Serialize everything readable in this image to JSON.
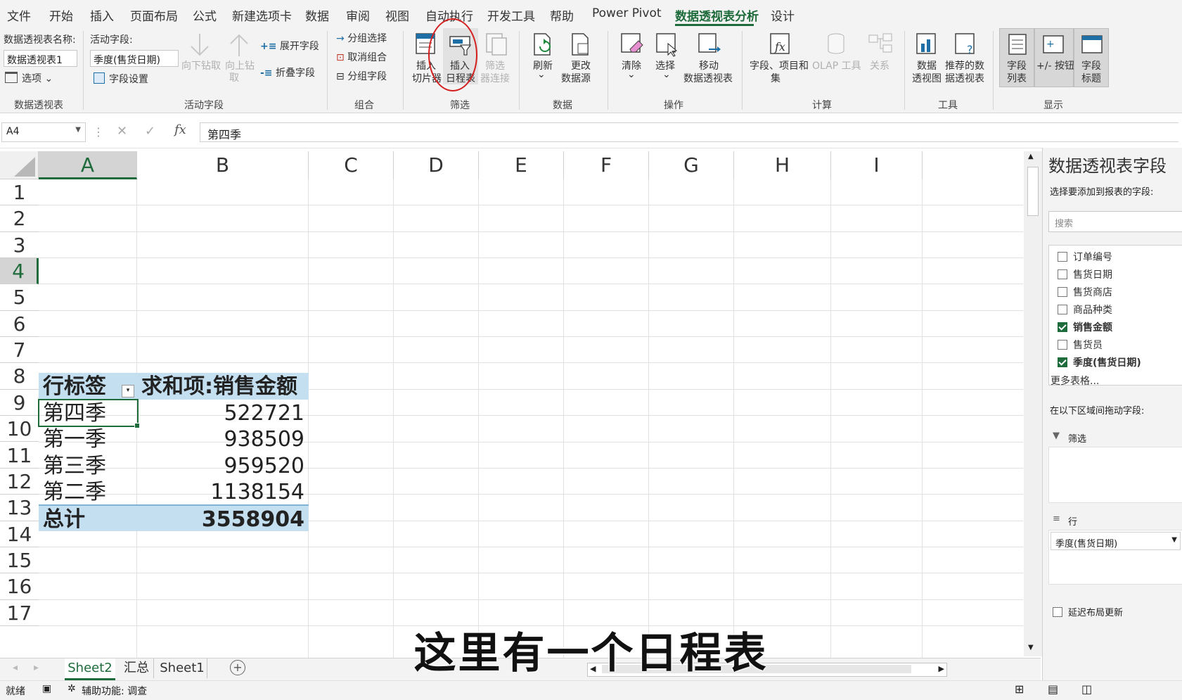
{
  "menu": [
    "文件",
    "开始",
    "插入",
    "页面布局",
    "公式",
    "新建选项卡",
    "数据",
    "审阅",
    "视图",
    "自动执行",
    "开发工具",
    "帮助",
    "Power Pivot",
    "数据透视表分析",
    "设计"
  ],
  "ribbon": {
    "pt_name_label": "数据透视表名称:",
    "pt_name_value": "数据透视表1",
    "options_label": "选项",
    "group_pivot": "数据透视表",
    "active_field_label": "活动字段:",
    "active_field_value": "季度(售货日期)",
    "field_settings": "字段设置",
    "drill_down": "向下钻取",
    "drill_up": "向上钻",
    "drill_up2": "取",
    "expand_field": "展开字段",
    "collapse_field": "折叠字段",
    "group_active": "活动字段",
    "group_selection": "分组选择",
    "ungroup": "取消组合",
    "group_field": "分组字段",
    "group_group": "组合",
    "slicer_1": "插入",
    "slicer_2": "切片器",
    "timeline_1": "插入",
    "timeline_2": "日程表",
    "filter_conn_1": "筛选",
    "filter_conn_2": "器连接",
    "group_filter": "筛选",
    "refresh": "刷新",
    "change_src_1": "更改",
    "change_src_2": "数据源",
    "group_data": "数据",
    "clear": "清除",
    "select": "选择",
    "move_1": "移动",
    "move_2": "数据透视表",
    "group_actions": "操作",
    "fields_items_1": "字段、项目和",
    "fields_items_2": "集",
    "olap": "OLAP 工具",
    "relations": "关系",
    "group_calc": "计算",
    "pivotchart_1": "数据",
    "pivotchart_2": "透视图",
    "recommended_1": "推荐的数",
    "recommended_2": "据透视表",
    "group_tools": "工具",
    "field_list_1": "字段",
    "field_list_2": "列表",
    "buttons_1": "+/- 按钮",
    "headers_1": "字段",
    "headers_2": "标题",
    "group_show": "显示"
  },
  "formula_bar": {
    "name_box": "A4",
    "fx": "fx",
    "value": "第四季"
  },
  "columns": [
    "A",
    "B",
    "C",
    "D",
    "E",
    "F",
    "G",
    "H",
    "I"
  ],
  "rows": [
    "1",
    "2",
    "3",
    "4",
    "5",
    "6",
    "7",
    "8",
    "9",
    "10",
    "11",
    "12",
    "13",
    "14",
    "15",
    "16",
    "17"
  ],
  "pivot": {
    "header_label": "行标签",
    "header_value": "求和项:销售金额",
    "rows": [
      {
        "label": "第四季",
        "value": "522721"
      },
      {
        "label": "第一季",
        "value": "938509"
      },
      {
        "label": "第三季",
        "value": "959520"
      },
      {
        "label": "第二季",
        "value": "1138154"
      }
    ],
    "total_label": "总计",
    "total_value": "3558904"
  },
  "sheets": [
    "Sheet2",
    "汇总",
    "Sheet1"
  ],
  "status": {
    "ready": "就绪",
    "accessibility": "辅助功能: 调查"
  },
  "panel": {
    "title": "数据透视表字段",
    "subtitle": "选择要添加到报表的字段:",
    "search_placeholder": "搜索",
    "fields": [
      {
        "name": "订单编号",
        "checked": false
      },
      {
        "name": "售货日期",
        "checked": false
      },
      {
        "name": "售货商店",
        "checked": false
      },
      {
        "name": "商品种类",
        "checked": false
      },
      {
        "name": "销售金额",
        "checked": true
      },
      {
        "name": "售货员",
        "checked": false
      },
      {
        "name": "季度(售货日期)",
        "checked": true
      }
    ],
    "more_tables": "更多表格...",
    "drag_label": "在以下区域间拖动字段:",
    "filter_area": "筛选",
    "rows_area": "行",
    "rows_value": "季度(售货日期)",
    "defer_update": "延迟布局更新"
  },
  "subtitle_caption": "这里有一个日程表"
}
